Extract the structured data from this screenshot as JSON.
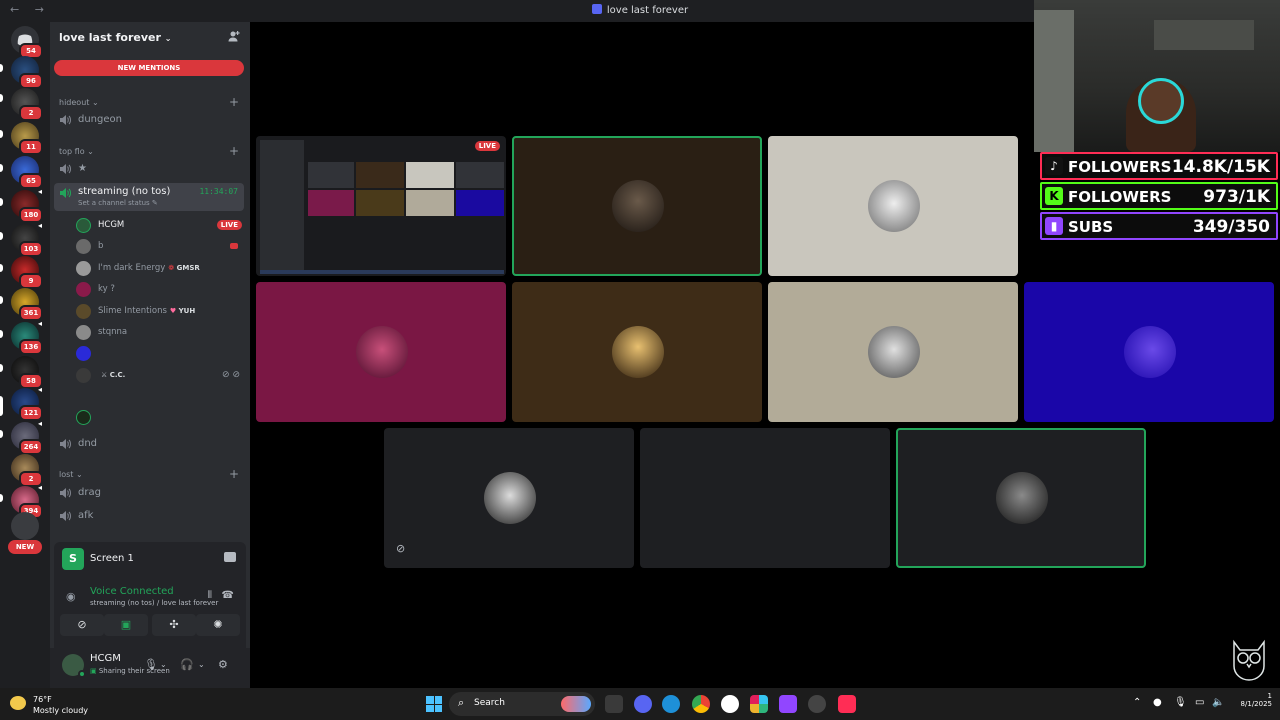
{
  "window": {
    "title": "love last forever",
    "nav_arrows": "← →"
  },
  "server_rail": {
    "badges": [
      "54",
      "96",
      "2",
      "11",
      "65",
      "180",
      "103",
      "9",
      "361",
      "136",
      "58",
      "121",
      "264",
      "2",
      "394"
    ],
    "new_label": "NEW"
  },
  "guild": {
    "name": "love last forever",
    "new_mentions": "NEW MENTIONS",
    "categories": [
      {
        "name": "hideout",
        "channels": [
          "dungeon"
        ]
      },
      {
        "name": "top flo",
        "channels": [
          "★"
        ]
      },
      {
        "name": "lost",
        "channels": [
          "drag",
          "afk"
        ]
      }
    ],
    "active_channel": {
      "name": "streaming (no tos)",
      "status_hint": "Set a channel status",
      "timer": "11:34:07"
    },
    "voice_users": [
      {
        "name": "HCGM",
        "tag": "",
        "live": "LIVE"
      },
      {
        "name": "b",
        "tag": ""
      },
      {
        "name": "I'm dark Energy",
        "tag": "GMSR"
      },
      {
        "name": "ky ?",
        "tag": ""
      },
      {
        "name": "Slime Intentions",
        "tag": "YUH"
      },
      {
        "name": "stqnna",
        "tag": ""
      },
      {
        "name": "",
        "tag": ""
      },
      {
        "name": "",
        "tag": "C.C."
      },
      {
        "name": "",
        "tag": ""
      }
    ],
    "other_channel": "dnd"
  },
  "panel": {
    "screen_name": "Screen 1",
    "voice_status": "Voice Connected",
    "voice_location": "streaming (no tos) / love last forever"
  },
  "user": {
    "name": "HCGM",
    "status": "Sharing their screen"
  },
  "stage": {
    "live_label": "LIVE"
  },
  "overlay": {
    "stats": [
      {
        "platform": "tiktok",
        "label": "FOLLOWERS",
        "value": "14.8K/15K",
        "color": "#ff2d55",
        "icon": "tiktok-icon"
      },
      {
        "platform": "kick",
        "label": "FOLLOWERS",
        "value": "973/1K",
        "color": "#53fc18",
        "icon": "kick-icon"
      },
      {
        "platform": "twitch",
        "label": "SUBS",
        "value": "349/350",
        "color": "#9146ff",
        "icon": "twitch-icon"
      }
    ]
  },
  "taskbar": {
    "temperature": "76°F",
    "weather": "Mostly cloudy",
    "search_placeholder": "Search",
    "clock_time": "1",
    "clock_date": "8/1/2025"
  }
}
